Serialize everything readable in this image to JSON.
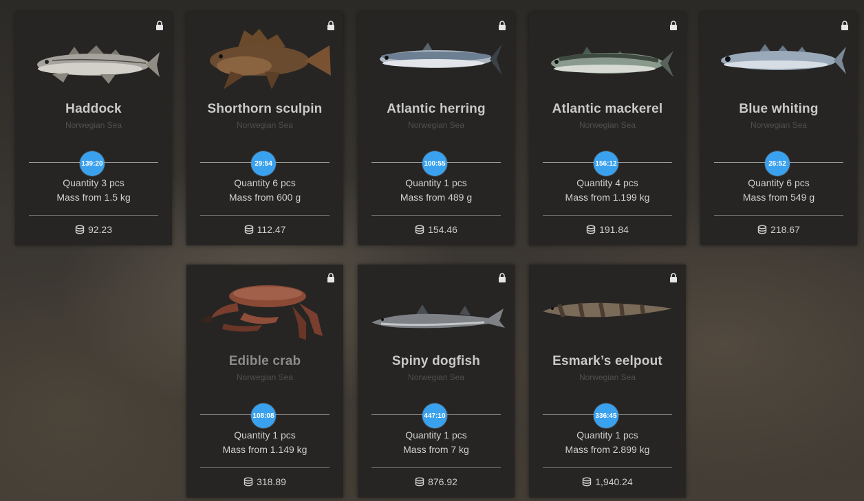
{
  "cards": [
    {
      "name": "Haddock",
      "region": "Norwegian Sea",
      "timer": "139:20",
      "quantity": "Quantity 3 pcs",
      "mass": "Mass from 1.5 kg",
      "price": "92.23",
      "icon": "lock-icon"
    },
    {
      "name": "Shorthorn sculpin",
      "region": "Norwegian Sea",
      "timer": "29:54",
      "quantity": "Quantity 6 pcs",
      "mass": "Mass from 600 g",
      "price": "112.47",
      "icon": "lock-icon"
    },
    {
      "name": "Atlantic herring",
      "region": "Norwegian Sea",
      "timer": "100:55",
      "quantity": "Quantity 1 pcs",
      "mass": "Mass from 489 g",
      "price": "154.46",
      "icon": "lock-icon"
    },
    {
      "name": "Atlantic mackerel",
      "region": "Norwegian Sea",
      "timer": "156:12",
      "quantity": "Quantity 4 pcs",
      "mass": "Mass from 1.199 kg",
      "price": "191.84",
      "icon": "lock-icon"
    },
    {
      "name": "Blue whiting",
      "region": "Norwegian Sea",
      "timer": "26:52",
      "quantity": "Quantity 6 pcs",
      "mass": "Mass from 549 g",
      "price": "218.67",
      "icon": "lock-icon"
    },
    {
      "name": "Edible crab",
      "region": "Norwegian Sea",
      "timer": "108:08",
      "quantity": "Quantity 1 pcs",
      "mass": "Mass from 1.149 kg",
      "price": "318.89",
      "icon": "lock-icon"
    },
    {
      "name": "Spiny dogfish",
      "region": "Norwegian Sea",
      "timer": "447:10",
      "quantity": "Quantity 1 pcs",
      "mass": "Mass from 7 kg",
      "price": "876.92",
      "icon": "lock-icon"
    },
    {
      "name": "Esmark’s eelpout",
      "region": "Norwegian Sea",
      "timer": "336:45",
      "quantity": "Quantity 1 pcs",
      "mass": "Mass from 2.899 kg",
      "price": "1,940.24",
      "icon": "lock-icon"
    }
  ],
  "colors": {
    "timer_badge": "#3aa1ee",
    "card_bg": "#262523",
    "name_text": "#c9c9c9",
    "region_text": "#4f4f4f"
  }
}
